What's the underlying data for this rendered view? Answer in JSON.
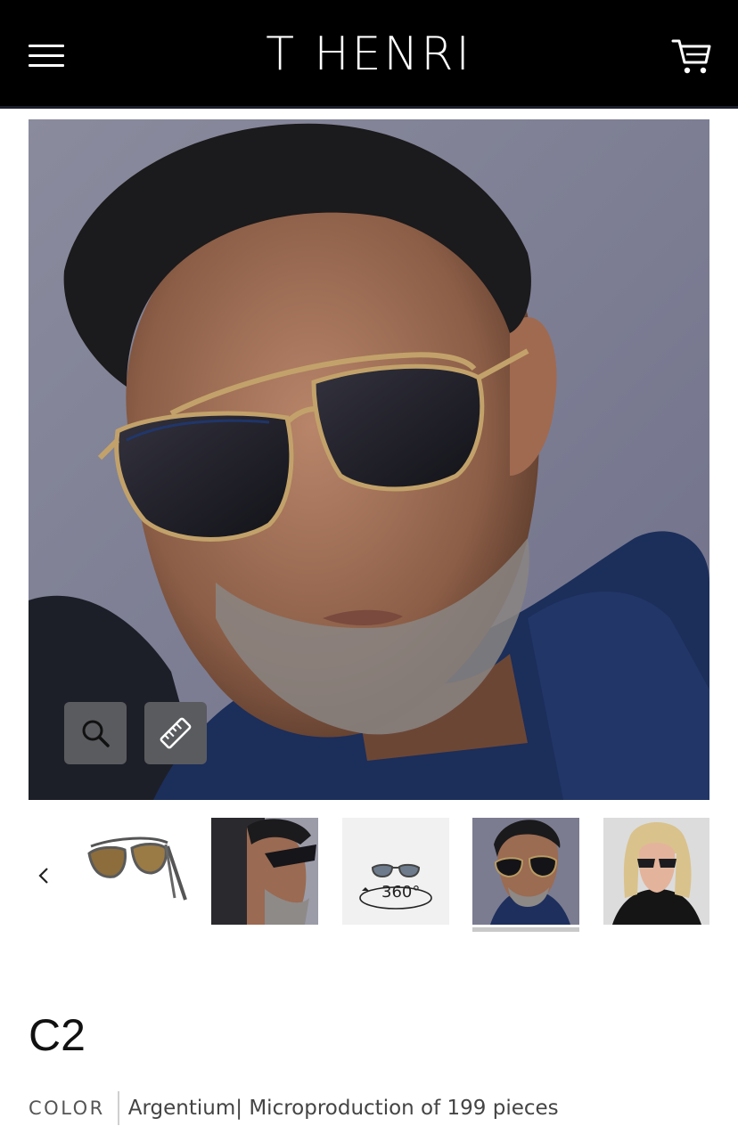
{
  "header": {
    "brand": "T HENRI",
    "menu_icon": "hamburger-menu-icon",
    "cart_icon": "shopping-cart-icon"
  },
  "hero": {
    "image_subject": "man wearing aviator-style sunglasses in navy jacket",
    "zoom_icon": "magnifier-icon",
    "measure_icon": "ruler-icon"
  },
  "gallery": {
    "prev_icon": "chevron-left-icon",
    "thumbnails": [
      {
        "label": "product-sunglasses"
      },
      {
        "label": "side-profile-model"
      },
      {
        "label": "360-view",
        "text": "360°"
      },
      {
        "label": "front-model",
        "active": true
      },
      {
        "label": "female-model"
      }
    ]
  },
  "product": {
    "variant": "C2",
    "color_label": "COLOR",
    "color_value": "Argentium| Microproduction of 199 pieces"
  },
  "colors": {
    "header_bg": "#000000",
    "tool_button_bg": "#5a5b5f",
    "active_underline": "#c9c9c9"
  }
}
